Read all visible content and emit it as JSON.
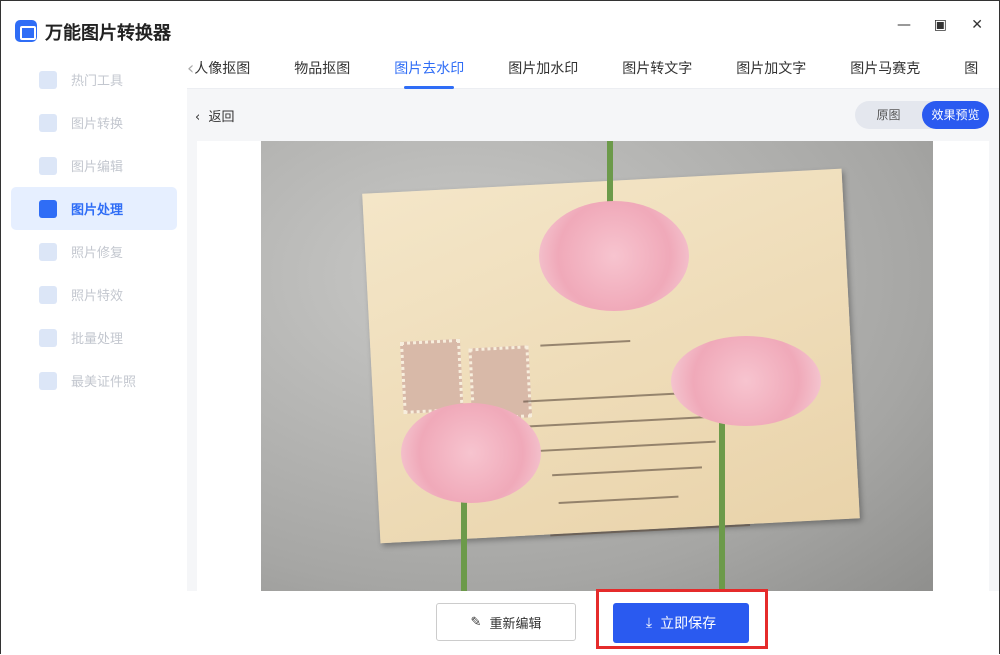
{
  "app": {
    "title": "万能图片转换器"
  },
  "sidebar": {
    "items": [
      {
        "label": "热门工具"
      },
      {
        "label": "图片转换"
      },
      {
        "label": "图片编辑"
      },
      {
        "label": "图片处理",
        "active": true
      },
      {
        "label": "照片修复"
      },
      {
        "label": "照片特效"
      },
      {
        "label": "批量处理"
      },
      {
        "label": "最美证件照"
      }
    ]
  },
  "window": {
    "minimize": "—",
    "maximize": "▣",
    "close": "✕"
  },
  "tabs": [
    {
      "label": "人像抠图"
    },
    {
      "label": "物品抠图"
    },
    {
      "label": "图片去水印",
      "active": true
    },
    {
      "label": "图片加水印"
    },
    {
      "label": "图片转文字"
    },
    {
      "label": "图片加文字"
    },
    {
      "label": "图片马赛克"
    },
    {
      "label": "图"
    }
  ],
  "subbar": {
    "back": "返回",
    "toggle_original": "原图",
    "toggle_preview": "效果预览"
  },
  "actions": {
    "reedit": "重新编辑",
    "save": "立即保存"
  },
  "colors": {
    "accent": "#2a5af0",
    "highlight": "#e52b2b"
  }
}
